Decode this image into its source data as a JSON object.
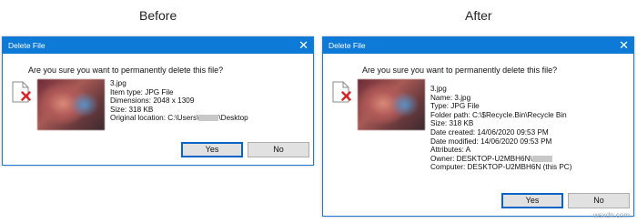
{
  "captions": {
    "before": "Before",
    "after": "After"
  },
  "before": {
    "title": "Delete File",
    "question": "Are you sure you want to permanently delete this file?",
    "details": [
      "3.jpg",
      "Item type: JPG File",
      "Dimensions: 2048 x 1309",
      "Size: 318 KB"
    ],
    "location_prefix": "Original location: C:\\Users\\",
    "location_suffix": "\\Desktop",
    "yes_label": "Yes",
    "no_label": "No"
  },
  "after": {
    "title": "Delete File",
    "question": "Are you sure you want to permanently delete this file?",
    "details": [
      "3.jpg",
      "Name: 3.jpg",
      "Type: JPG File",
      "Folder path: C:\\$Recycle.Bin\\Recycle Bin",
      "Size: 318 KB",
      "Date created: 14/06/2020 09:53 PM",
      "Date modified: 14/06/2020 09:53 PM",
      "Attributes: A"
    ],
    "owner_prefix": "Owner: DESKTOP-U2MBH6N\\",
    "computer_line": "Computer: DESKTOP-U2MBH6N (this PC)",
    "yes_label": "Yes",
    "no_label": "No"
  },
  "watermark": "wsxdn.com",
  "icons": {
    "close": "close-icon",
    "file": "file-icon",
    "delete_mark": "red-x-icon"
  }
}
